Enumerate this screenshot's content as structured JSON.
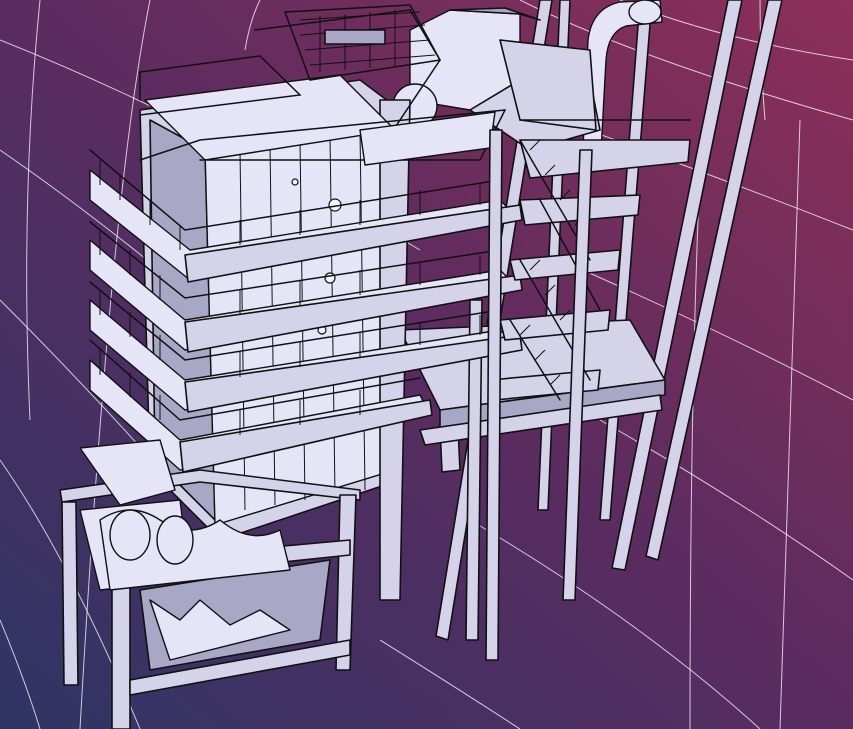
{
  "viewport": {
    "background_gradient": [
      "#353466",
      "#5a2d5f",
      "#8a2f5a"
    ],
    "grid_color": "#ffffff",
    "model_fill": "#d4d3ea",
    "model_edge": "#111111"
  },
  "model": {
    "parts": [
      "tower-body",
      "top-deck",
      "dust-collector-housing",
      "exhaust-duct",
      "platform-level-1",
      "platform-level-2",
      "platform-level-3",
      "platform-level-4",
      "stair-tower",
      "support-column",
      "hopper-base",
      "conveyor-trough",
      "drum-dryer-base"
    ]
  }
}
